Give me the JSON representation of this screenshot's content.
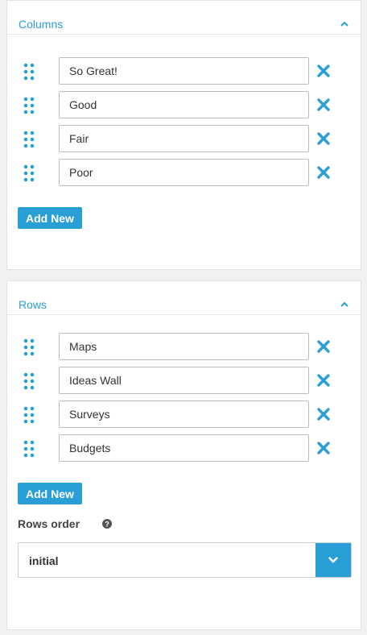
{
  "columns_panel": {
    "title": "Columns",
    "items": [
      "So Great!",
      "Good",
      "Fair",
      "Poor"
    ],
    "add_label": "Add New"
  },
  "rows_panel": {
    "title": "Rows",
    "items": [
      "Maps",
      "Ideas Wall",
      "Surveys",
      "Budgets"
    ],
    "add_label": "Add New",
    "order_label": "Rows order",
    "order_value": "initial"
  },
  "icons": {
    "drag": "drag-handle-icon",
    "remove": "close-icon",
    "collapse": "chevron-up-icon",
    "help": "help-icon",
    "select": "chevron-down-icon"
  },
  "colors": {
    "accent": "#2a9fd6",
    "background": "#f1f1f1",
    "panel_border": "#e2e2e2"
  }
}
